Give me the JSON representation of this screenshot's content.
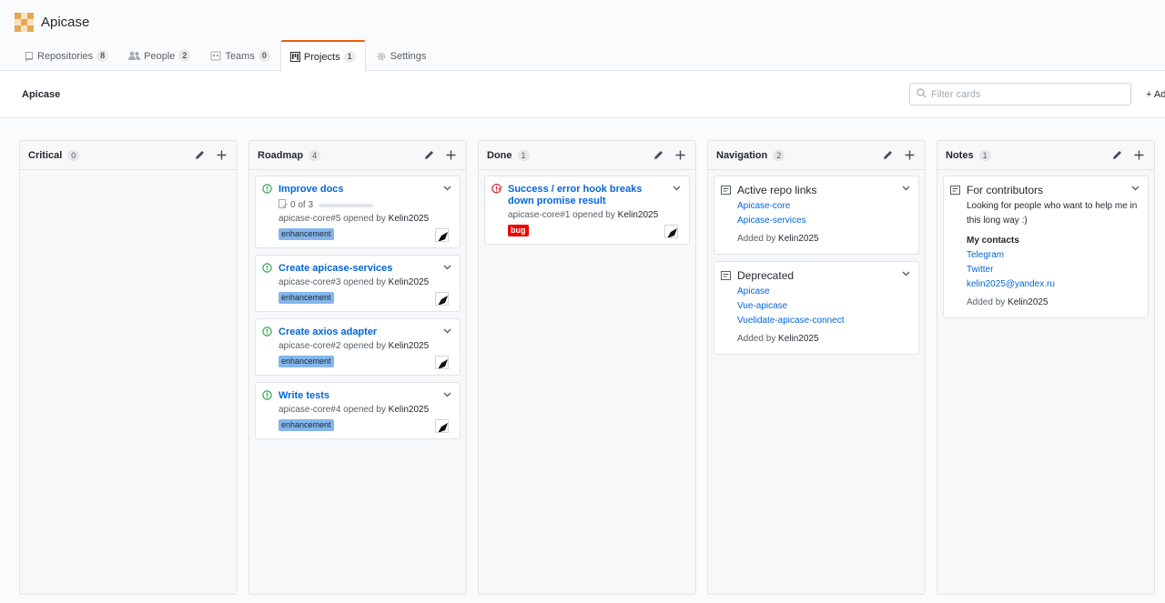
{
  "org": {
    "name": "Apicase"
  },
  "tabs": [
    {
      "label": "Repositories",
      "count": "8"
    },
    {
      "label": "People",
      "count": "2"
    },
    {
      "label": "Teams",
      "count": "0"
    },
    {
      "label": "Projects",
      "count": "1"
    },
    {
      "label": "Settings"
    }
  ],
  "project": {
    "name": "Apicase",
    "filter_placeholder": "Filter cards",
    "add_cards_label": "Ad"
  },
  "columns": [
    {
      "title": "Critical",
      "count": "0"
    },
    {
      "title": "Roadmap",
      "count": "4",
      "cards": [
        {
          "title": "Improve docs",
          "progress": "0 of 3",
          "meta": "apicase-core#5 opened by",
          "user": "Kelin2025",
          "label": "enhancement"
        },
        {
          "title": "Create apicase-services",
          "meta": "apicase-core#3 opened by",
          "user": "Kelin2025",
          "label": "enhancement"
        },
        {
          "title": "Create axios adapter",
          "meta": "apicase-core#2 opened by",
          "user": "Kelin2025",
          "label": "enhancement"
        },
        {
          "title": "Write tests",
          "meta": "apicase-core#4 opened by",
          "user": "Kelin2025",
          "label": "enhancement"
        }
      ]
    },
    {
      "title": "Done",
      "count": "1",
      "cards": [
        {
          "title": "Success / error hook breaks down promise result",
          "meta": "apicase-core#1 opened by",
          "user": "Kelin2025",
          "label": "bug"
        }
      ]
    },
    {
      "title": "Navigation",
      "count": "2",
      "notes": [
        {
          "title": "Active repo links",
          "links": [
            "Apicase-core",
            "Apicase-services"
          ],
          "added": "Added by",
          "user": "Kelin2025"
        },
        {
          "title": "Deprecated",
          "links": [
            "Apicase",
            "Vue-apicase",
            "Vuelidate-apicase-connect"
          ],
          "added": "Added by",
          "user": "Kelin2025"
        }
      ]
    },
    {
      "title": "Notes",
      "count": "1",
      "notes": [
        {
          "title": "For contributors",
          "text": "Looking for people who want to help me in this long way :)",
          "subheading": "My contacts",
          "links": [
            "Telegram",
            "Twitter",
            "kelin2025@yandex.ru"
          ],
          "added": "Added by",
          "user": "Kelin2025"
        }
      ]
    }
  ],
  "colors": {
    "link": "#0366d6",
    "open": "#28a745",
    "closed": "#cb2431",
    "enhancement": "#84b6eb",
    "bug": "#ee0701",
    "tab_accent": "#e36209"
  }
}
